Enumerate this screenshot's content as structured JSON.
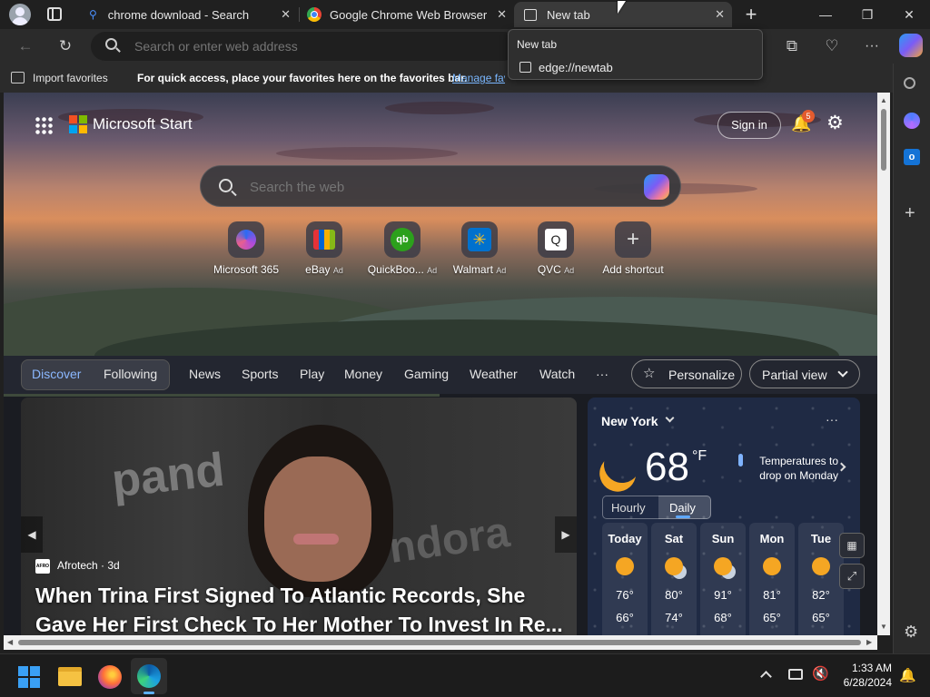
{
  "tabs": [
    {
      "title": "chrome download - Search",
      "icon": "bing-search-icon"
    },
    {
      "title": "Google Chrome Web Browser",
      "icon": "chrome-icon"
    },
    {
      "title": "New tab",
      "icon": "newtab-icon"
    }
  ],
  "tooltip": {
    "title": "New tab",
    "url": "edge://newtab"
  },
  "address": {
    "placeholder": "Search or enter web address"
  },
  "favorites": {
    "import_label": "Import favorites",
    "message": "For quick access, place your favorites here on the favorites bar.",
    "manage_link": "Manage favorites now"
  },
  "page": {
    "brand": "Microsoft Start",
    "sign_in": "Sign in",
    "notification_count": "5",
    "search_placeholder": "Search the web",
    "quick_links": [
      {
        "label": "Microsoft 365",
        "ad": ""
      },
      {
        "label": "eBay",
        "ad": "Ad"
      },
      {
        "label": "QuickBoo...",
        "ad": "Ad"
      },
      {
        "label": "Walmart",
        "ad": "Ad"
      },
      {
        "label": "QVC",
        "ad": "Ad"
      },
      {
        "label": "Add shortcut",
        "ad": ""
      }
    ],
    "categories": {
      "discover": "Discover",
      "following": "Following",
      "items": [
        "News",
        "Sports",
        "Play",
        "Money",
        "Gaming",
        "Weather",
        "Watch"
      ],
      "more": "···",
      "personalize": "Personalize",
      "partial_view": "Partial view"
    },
    "news": {
      "source": "Afrotech",
      "age": "3d",
      "headline": "When Trina First Signed To Atlantic Records, She Gave Her First Check To Her Mother To Invest In Re..."
    },
    "weather": {
      "location": "New York",
      "temp": "68",
      "unit": "°F",
      "alert": "Temperatures to drop on Monday",
      "tab_hourly": "Hourly",
      "tab_daily": "Daily",
      "forecast": [
        {
          "day": "Today",
          "icon": "sun-icon",
          "hi": "76°",
          "lo": "66°"
        },
        {
          "day": "Sat",
          "icon": "partly-cloudy-icon",
          "hi": "80°",
          "lo": "74°"
        },
        {
          "day": "Sun",
          "icon": "partly-cloudy-icon",
          "hi": "91°",
          "lo": "68°"
        },
        {
          "day": "Mon",
          "icon": "sun-icon",
          "hi": "81°",
          "lo": "65°"
        },
        {
          "day": "Tue",
          "icon": "sun-icon",
          "hi": "82°",
          "lo": "65°"
        }
      ]
    }
  },
  "taskbar": {
    "time": "1:33 AM",
    "date": "6/28/2024"
  }
}
